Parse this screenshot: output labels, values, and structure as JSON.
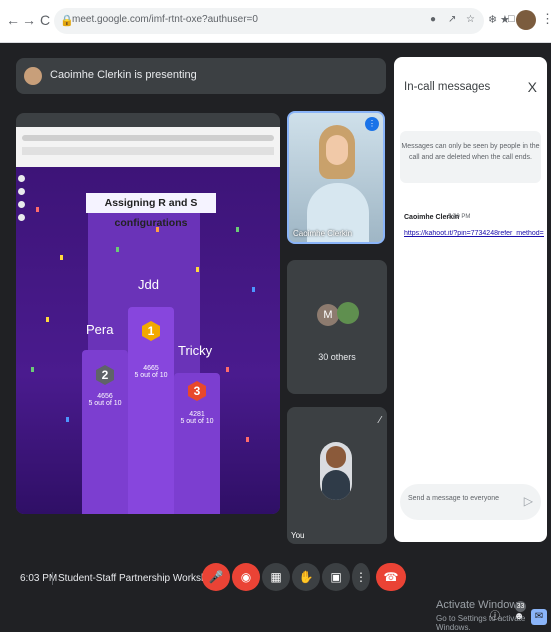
{
  "browser": {
    "nav_back": "←",
    "nav_forward": "→",
    "nav_reload": "C",
    "url": "meet.google.com/imf-rtnt-oxe?authuser=0"
  },
  "presenting": {
    "text": "Caoimhe Clerkin is presenting"
  },
  "shared_screen": {
    "question": "Assigning R and S configurations",
    "podium": [
      {
        "name": "Pera",
        "rank": "2",
        "score": "4656",
        "detail": "5 out of 10",
        "color": "#5f6368"
      },
      {
        "name": "Jdd",
        "rank": "1",
        "score": "4665",
        "detail": "5 out of 10",
        "color": "#f2a900"
      },
      {
        "name": "Tricky",
        "rank": "3",
        "score": "4281",
        "detail": "5 out of 10",
        "color": "#e8482c"
      }
    ]
  },
  "tiles": {
    "presenter_name": "Caoimhe Clerkin",
    "others_initial": "M",
    "others_count": "30 others",
    "you_label": "You"
  },
  "chat": {
    "title": "In-call messages",
    "close": "X",
    "notice": "Messages can only be seen by people in the call and are deleted when the call ends.",
    "message": {
      "author": "Caoimhe Clerkin",
      "time": "5:49 PM",
      "link": "https://kahoot.it/?pin=7734248refer_method=link"
    },
    "input_placeholder": "Send a message to everyone"
  },
  "bottom": {
    "time": "6:03 PM",
    "title": "Student-Staff Partnership Workshop",
    "people_count": "33",
    "activate_title": "Activate Windows",
    "activate_sub": "Go to Settings to activate Windows."
  }
}
